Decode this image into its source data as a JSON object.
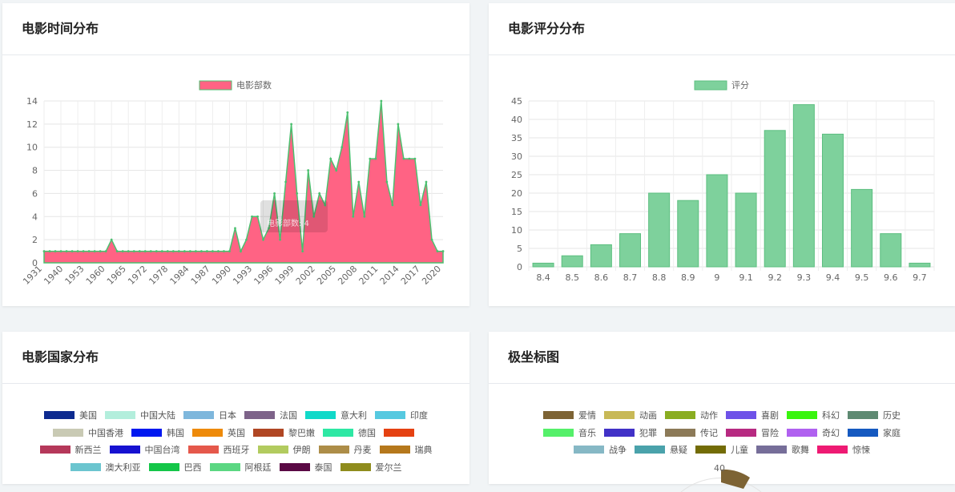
{
  "cards": {
    "time": {
      "title": "电影时间分布"
    },
    "rating": {
      "title": "电影评分分布"
    },
    "country": {
      "title": "电影国家分布"
    },
    "polar": {
      "title": "极坐标图"
    }
  },
  "colors": {
    "time_fill": "#ff6384",
    "time_line": "#4bc06f",
    "rating_bar": "#7ed19c",
    "rating_border": "#5cbf80"
  },
  "chart_data": [
    {
      "type": "area",
      "title": "",
      "legend": "电影部数",
      "legend_position": "top",
      "ylim": [
        0,
        14
      ],
      "yticks": [
        "0",
        "2",
        "4",
        "6",
        "8",
        "10",
        "12",
        "14"
      ],
      "xtick_labels": [
        "1931",
        "1940",
        "1953",
        "1960",
        "1965",
        "1972",
        "1978",
        "1984",
        "1987",
        "1990",
        "1993",
        "1996",
        "1999",
        "2002",
        "2005",
        "2008",
        "2011",
        "2014",
        "2017",
        "2020"
      ],
      "tooltip": "电影部数: 4",
      "values": [
        1,
        1,
        1,
        1,
        1,
        1,
        1,
        1,
        1,
        1,
        1,
        1,
        2,
        1,
        1,
        1,
        1,
        1,
        1,
        1,
        1,
        1,
        1,
        1,
        1,
        1,
        1,
        1,
        1,
        1,
        1,
        1,
        1,
        1,
        3,
        1,
        2,
        4,
        4,
        2,
        3,
        6,
        2,
        7,
        12,
        6,
        1,
        8,
        4,
        6,
        5,
        9,
        8,
        10,
        13,
        4,
        7,
        4,
        9,
        9,
        14,
        7,
        5,
        12,
        9,
        9,
        9,
        5,
        7,
        2,
        1,
        1
      ]
    },
    {
      "type": "bar",
      "title": "",
      "legend": "评分",
      "legend_position": "top",
      "ylim": [
        0,
        45
      ],
      "yticks": [
        "0",
        "5",
        "10",
        "15",
        "20",
        "25",
        "30",
        "35",
        "40",
        "45"
      ],
      "categories": [
        "8.4",
        "8.5",
        "8.6",
        "8.7",
        "8.8",
        "8.9",
        "9",
        "9.1",
        "9.2",
        "9.3",
        "9.4",
        "9.5",
        "9.6",
        "9.7"
      ],
      "values": [
        1,
        3,
        6,
        9,
        20,
        18,
        25,
        20,
        37,
        44,
        36,
        21,
        9,
        1
      ]
    }
  ],
  "country_legend": [
    [
      {
        "label": "美国",
        "color": "#0d2a8f"
      },
      {
        "label": "中国大陆",
        "color": "#b3eedc"
      },
      {
        "label": "日本",
        "color": "#7eb7dc"
      },
      {
        "label": "法国",
        "color": "#7d6389"
      },
      {
        "label": "意大利",
        "color": "#11d9c9"
      },
      {
        "label": "印度",
        "color": "#56c9e0"
      }
    ],
    [
      {
        "label": "中国香港",
        "color": "#c9cab4"
      },
      {
        "label": "韩国",
        "color": "#0018f0"
      },
      {
        "label": "英国",
        "color": "#ee8a0a"
      },
      {
        "label": "黎巴嫩",
        "color": "#b04623"
      },
      {
        "label": "德国",
        "color": "#2ee8a4"
      },
      {
        "label": "",
        "color": "#e54111"
      }
    ],
    [
      {
        "label": "新西兰",
        "color": "#b5385a"
      },
      {
        "label": "中国台湾",
        "color": "#1611d1"
      },
      {
        "label": "西班牙",
        "color": "#e5584b"
      },
      {
        "label": "伊朗",
        "color": "#b2cb5f"
      },
      {
        "label": "丹麦",
        "color": "#ad8d48"
      },
      {
        "label": "瑞典",
        "color": "#b5781c"
      }
    ],
    [
      {
        "label": "澳大利亚",
        "color": "#6bc5cf"
      },
      {
        "label": "巴西",
        "color": "#14c648"
      },
      {
        "label": "阿根廷",
        "color": "#5bd782"
      },
      {
        "label": "泰国",
        "color": "#5a0944"
      },
      {
        "label": "爱尔兰",
        "color": "#8f8c1d"
      }
    ]
  ],
  "polar_legend": [
    [
      {
        "label": "爱情",
        "color": "#7d6334"
      },
      {
        "label": "动画",
        "color": "#c8b957"
      },
      {
        "label": "动作",
        "color": "#8aad21"
      },
      {
        "label": "喜剧",
        "color": "#6e52e8"
      },
      {
        "label": "科幻",
        "color": "#39f50e"
      },
      {
        "label": "历史",
        "color": "#5e8a72"
      }
    ],
    [
      {
        "label": "音乐",
        "color": "#55f06a"
      },
      {
        "label": "犯罪",
        "color": "#4131c7"
      },
      {
        "label": "传记",
        "color": "#8c7a58"
      },
      {
        "label": "冒险",
        "color": "#b72a81"
      },
      {
        "label": "奇幻",
        "color": "#b061f0"
      },
      {
        "label": "家庭",
        "color": "#1559c0"
      }
    ],
    [
      {
        "label": "战争",
        "color": "#86b8c5"
      },
      {
        "label": "悬疑",
        "color": "#4aa2ab"
      },
      {
        "label": "儿童",
        "color": "#736c06"
      },
      {
        "label": "歌舞",
        "color": "#766e99"
      },
      {
        "label": "惊悚",
        "color": "#ee1a73"
      }
    ]
  ],
  "polar": {
    "tick_top": "40"
  }
}
